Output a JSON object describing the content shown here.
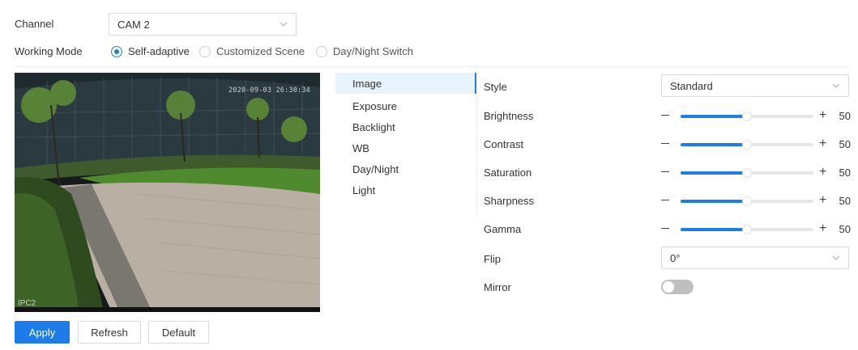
{
  "channel": {
    "label": "Channel",
    "value": "CAM 2"
  },
  "working_mode": {
    "label": "Working Mode",
    "options": [
      {
        "label": "Self-adaptive",
        "checked": true
      },
      {
        "label": "Customized Scene",
        "checked": false
      },
      {
        "label": "Day/Night Switch",
        "checked": false
      }
    ]
  },
  "preview": {
    "timestamp": "2020-09-03 26:30:34",
    "camera_label": "IPC2"
  },
  "menu": {
    "items": [
      "Image",
      "Exposure",
      "Backlight",
      "WB",
      "Day/Night",
      "Light"
    ],
    "active": "Image"
  },
  "settings": {
    "style": {
      "label": "Style",
      "value": "Standard"
    },
    "sliders": [
      {
        "label": "Brightness",
        "value": "50",
        "level": 0.5
      },
      {
        "label": "Contrast",
        "value": "50",
        "level": 0.5
      },
      {
        "label": "Saturation",
        "value": "50",
        "level": 0.5
      },
      {
        "label": "Sharpness",
        "value": "50",
        "level": 0.5
      },
      {
        "label": "Gamma",
        "value": "50",
        "level": 0.5
      }
    ],
    "flip": {
      "label": "Flip",
      "value": "0°"
    },
    "mirror": {
      "label": "Mirror",
      "on": false
    }
  },
  "buttons": {
    "apply": "Apply",
    "refresh": "Refresh",
    "default": "Default"
  },
  "colors": {
    "accent": "#1e7ce8",
    "menu_active_bg": "#e8f3fe",
    "toggle_off": "#bfbfbf"
  }
}
